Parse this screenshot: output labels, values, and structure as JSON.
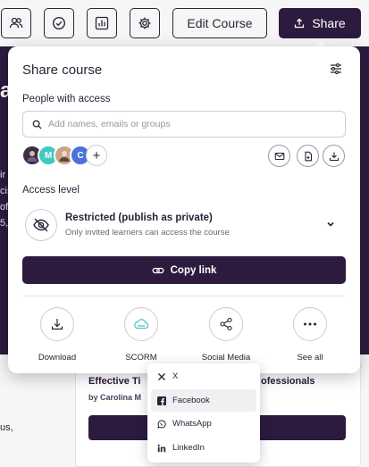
{
  "toolbar": {
    "edit_course_label": "Edit Course",
    "share_label": "Share"
  },
  "background": {
    "hero_letter": "a",
    "hero_text_line1": "ir",
    "hero_text_line2": "cis",
    "hero_text_line3": "of",
    "hero_text_line4": "5,",
    "card_title_start": "Effective Ti",
    "card_title_end": "ofessionals",
    "card_author": "by Carolina M",
    "side_text": "us,"
  },
  "share_panel": {
    "title": "Share course",
    "people_label": "People with access",
    "search_placeholder": "Add names, emails or groups",
    "avatars": [
      {
        "initial": "",
        "color": "#3a2f44"
      },
      {
        "initial": "M",
        "color": "#3fc9c3"
      },
      {
        "initial": "",
        "color": "#c9a48b"
      },
      {
        "initial": "C",
        "color": "#4a72d8"
      }
    ],
    "access_label": "Access level",
    "access_title": "Restricted (publish as private)",
    "access_desc": "Only invited learners can access the course",
    "copy_link_label": "Copy link",
    "options": [
      {
        "label": "Download",
        "icon": "download-icon"
      },
      {
        "label": "SCORM",
        "icon": "cloud-icon"
      },
      {
        "label": "Social Media",
        "icon": "share-nodes-icon"
      },
      {
        "label": "See all",
        "icon": "more-dots-icon"
      }
    ]
  },
  "social_menu": {
    "items": [
      {
        "label": "X",
        "icon": "x-logo-icon"
      },
      {
        "label": "Facebook",
        "icon": "facebook-icon"
      },
      {
        "label": "WhatsApp",
        "icon": "whatsapp-icon"
      },
      {
        "label": "LinkedIn",
        "icon": "linkedin-icon"
      }
    ]
  },
  "colors": {
    "brand": "#2d1b3f",
    "accent_cyan": "#3fc9c3"
  }
}
